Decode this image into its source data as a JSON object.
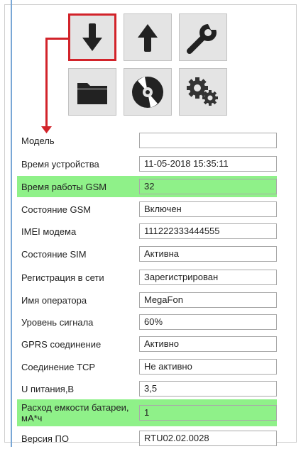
{
  "toolbar": {
    "buttons": [
      {
        "name": "download",
        "icon": "arrow-down-icon",
        "selected": true
      },
      {
        "name": "upload",
        "icon": "arrow-up-icon",
        "selected": false
      },
      {
        "name": "settings",
        "icon": "wrench-icon",
        "selected": false
      },
      {
        "name": "folder",
        "icon": "folder-icon",
        "selected": false
      },
      {
        "name": "disk",
        "icon": "disc-icon",
        "selected": false
      },
      {
        "name": "config",
        "icon": "gears-icon",
        "selected": false
      }
    ]
  },
  "colors": {
    "highlight": "#8ff189",
    "selection": "#d2232a"
  },
  "fields": [
    {
      "label": "Модель",
      "value": ""
    },
    {
      "label": "Время устройства",
      "value": "11-05-2018 15:35:11"
    },
    {
      "label": "Время работы GSM",
      "value": "32",
      "highlighted": true
    },
    {
      "label": "Состояние GSM",
      "value": "Включен"
    },
    {
      "label": "IMEI модема",
      "value": "111222333444555"
    },
    {
      "label": "Состояние SIM",
      "value": "Активна"
    },
    {
      "label": "Регистрация в сети",
      "value": "Зарегистрирован"
    },
    {
      "label": "Имя оператора",
      "value": "MegaFon"
    },
    {
      "label": "Уровень сигнала",
      "value": "60%"
    },
    {
      "label": "GPRS соединение",
      "value": "Активно"
    },
    {
      "label": "Соединение TCP",
      "value": "Не активно"
    },
    {
      "label": "U питания,В",
      "value": "3,5"
    },
    {
      "label": "Расход емкости батареи, мА*ч",
      "value": "1",
      "highlighted": true
    },
    {
      "label": "Версия ПО",
      "value": "RTU02.02.0028"
    }
  ]
}
